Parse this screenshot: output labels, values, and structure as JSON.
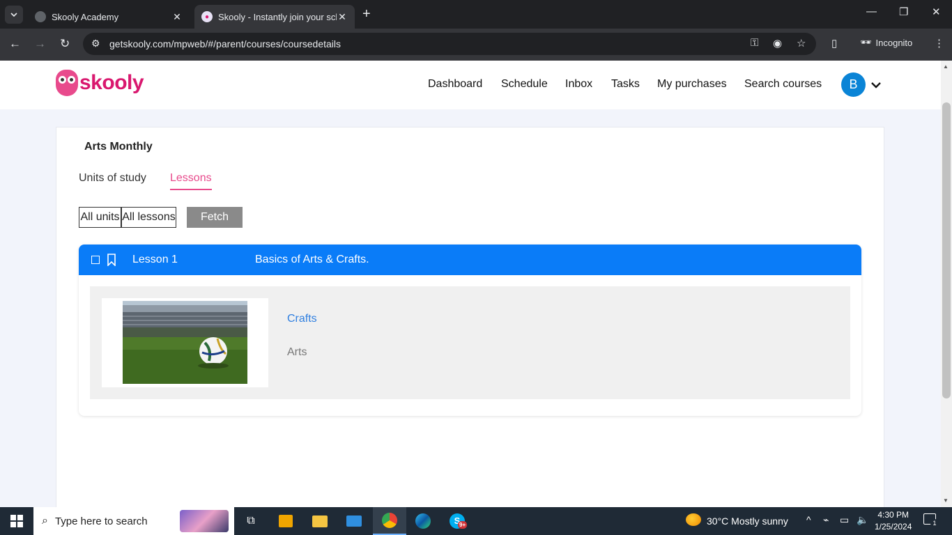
{
  "browser": {
    "tabs": [
      {
        "title": "Skooly Academy",
        "active": false
      },
      {
        "title": "Skooly - Instantly join your scho",
        "active": true
      }
    ],
    "url": "getskooly.com/mpweb/#/parent/courses/coursedetails",
    "incognito_label": "Incognito"
  },
  "site": {
    "logo_text": "skooly",
    "nav": [
      "Dashboard",
      "Schedule",
      "Inbox",
      "Tasks",
      "My purchases",
      "Search courses"
    ],
    "avatar_initial": "B",
    "colors": {
      "brand": "#d9186f",
      "accent_blue": "#0a7cf8",
      "tab_active": "#e84a8c"
    }
  },
  "course": {
    "title": "Arts Monthly",
    "tabs": {
      "units": "Units of study",
      "lessons": "Lessons"
    },
    "active_tab": "Lessons",
    "filters": {
      "units_selected": "All units",
      "lessons_selected": "All lessons",
      "fetch_label": "Fetch"
    },
    "lesson": {
      "number": "Lesson 1",
      "name": "Basics of Arts & Crafts.",
      "category": "Crafts",
      "subject": "Arts",
      "image_icon": "soccer-ball-stadium-image"
    }
  },
  "taskbar": {
    "search_placeholder": "Type here to search",
    "weather": "30°C  Mostly sunny",
    "time": "4:30 PM",
    "date": "1/25/2024",
    "notification_count": "1",
    "skype_badge": "9+"
  }
}
